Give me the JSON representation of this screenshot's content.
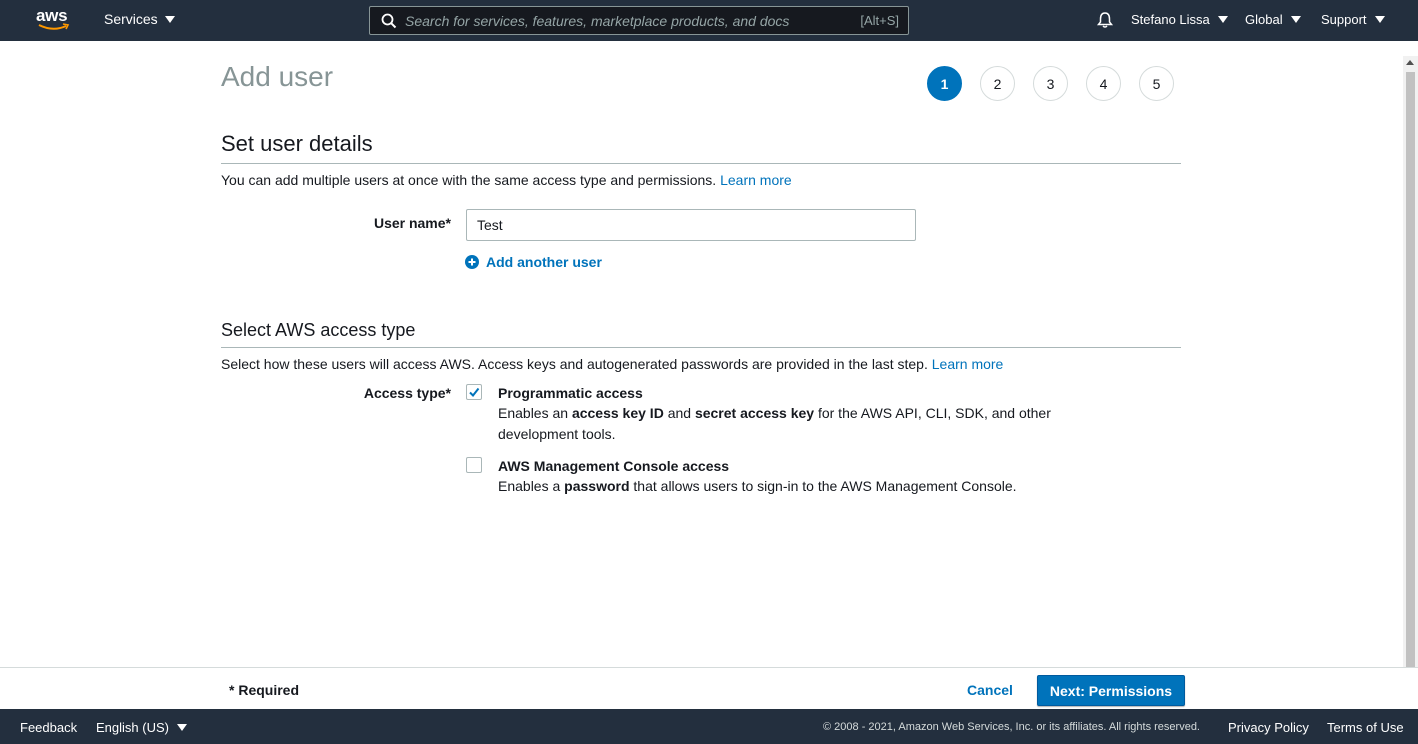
{
  "topnav": {
    "logo": "aws",
    "services_label": "Services",
    "search_placeholder": "Search for services, features, marketplace products, and docs",
    "search_shortcut": "[Alt+S]",
    "user_label": "Stefano Lissa",
    "region_label": "Global",
    "support_label": "Support"
  },
  "page": {
    "title": "Add user",
    "steps": [
      "1",
      "2",
      "3",
      "4",
      "5"
    ],
    "active_step": 1
  },
  "details": {
    "title": "Set user details",
    "description": "You can add multiple users at once with the same access type and permissions.",
    "learn_more": "Learn more",
    "username_label": "User name*",
    "username_value": "Test",
    "add_another_label": "Add another user"
  },
  "access": {
    "title": "Select AWS access type",
    "description": "Select how these users will access AWS. Access keys and autogenerated passwords are provided in the last step.",
    "learn_more": "Learn more",
    "type_label": "Access type*",
    "programmatic": {
      "title": "Programmatic access",
      "checked": true,
      "desc_1": "Enables an",
      "desc_b1": "access key ID",
      "desc_2": "and",
      "desc_b2": "secret access key",
      "desc_3": "for the AWS API, CLI, SDK, and other development tools."
    },
    "console": {
      "title": "AWS Management Console access",
      "checked": false,
      "desc_1": "Enables a",
      "desc_b1": "password",
      "desc_2": "that allows users to sign-in to the AWS Management Console."
    }
  },
  "footer": {
    "required": "* Required",
    "cancel": "Cancel",
    "next": "Next: Permissions"
  },
  "bottombar": {
    "feedback": "Feedback",
    "language": "English (US)",
    "copyright": "© 2008 - 2021, Amazon Web Services, Inc. or its affiliates. All rights reserved.",
    "privacy": "Privacy Policy",
    "terms": "Terms of Use"
  },
  "colors": {
    "nav_bg": "#232f3e",
    "primary": "#0073bb",
    "link": "#0073bb",
    "title_gray": "#879596"
  }
}
